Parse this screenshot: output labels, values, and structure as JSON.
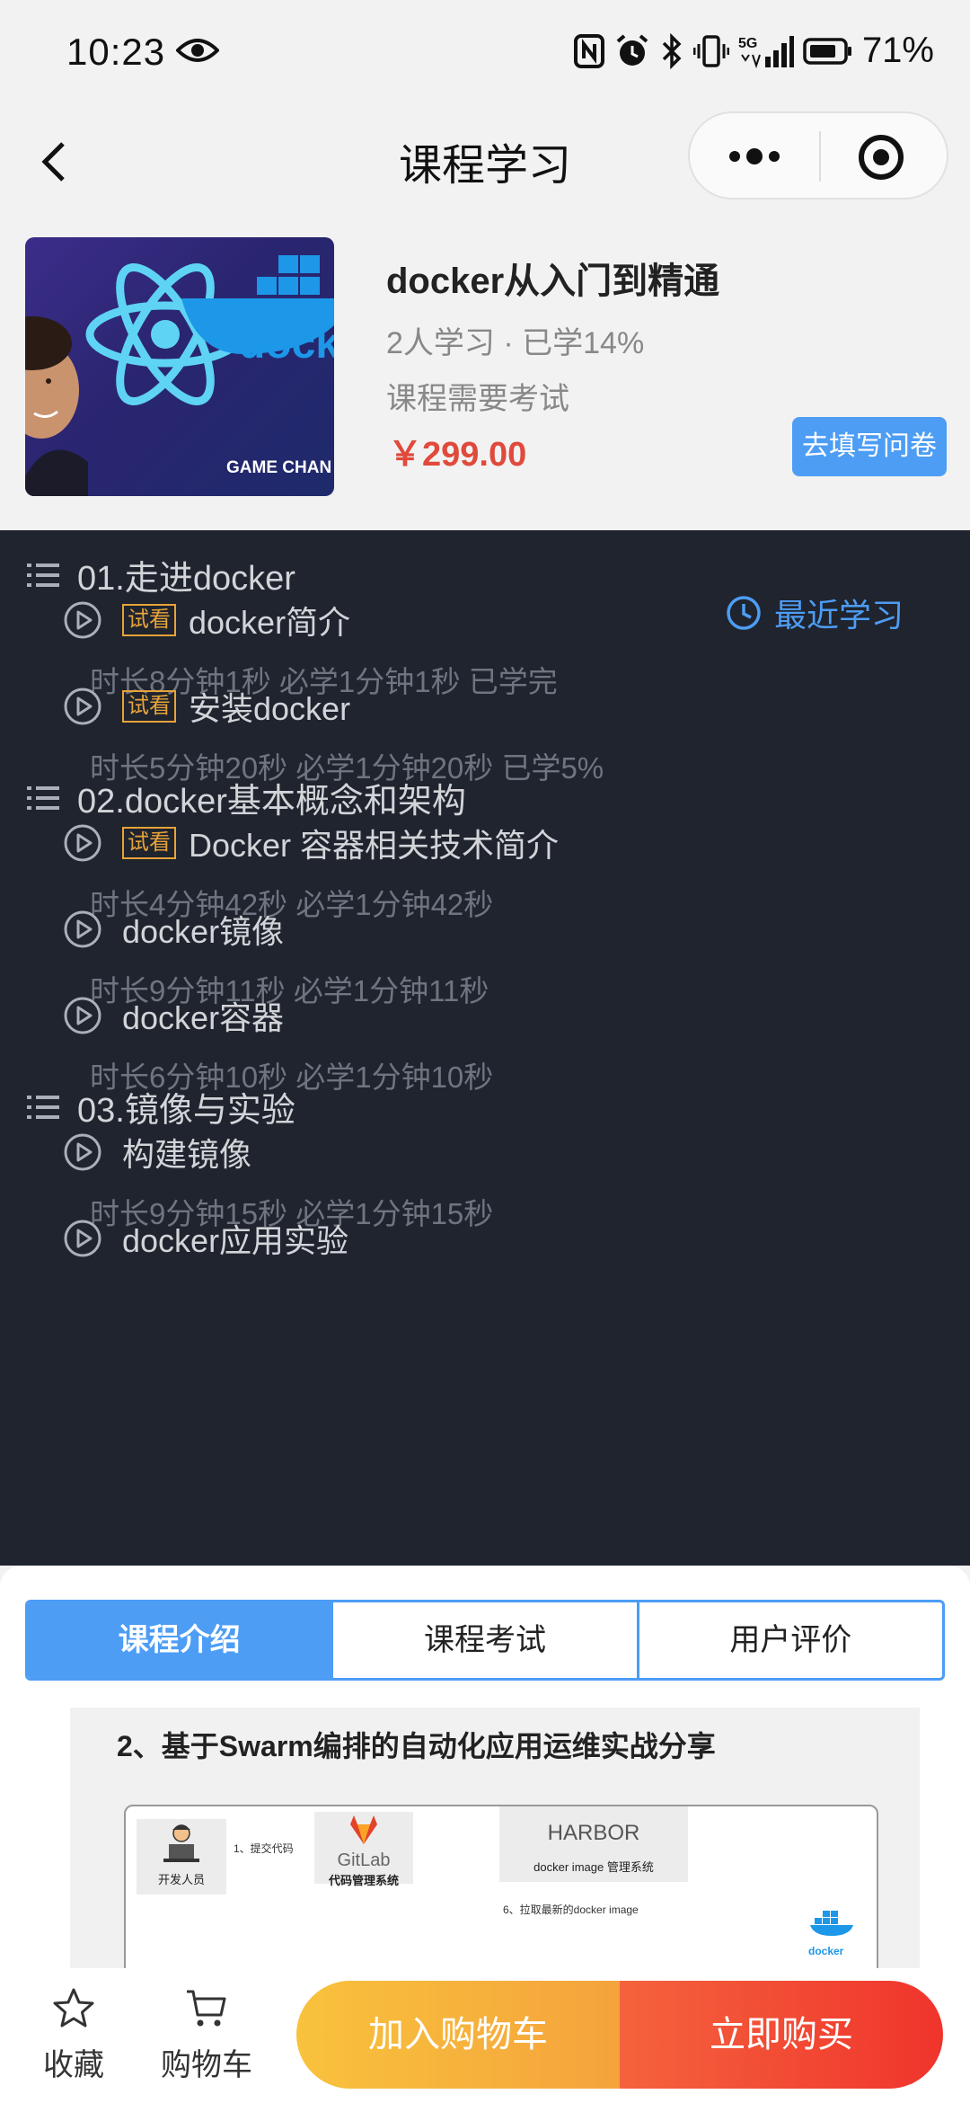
{
  "status_bar": {
    "time": "10:23",
    "network": "5G",
    "battery": "71%"
  },
  "nav": {
    "title": "课程学习"
  },
  "course": {
    "title": "docker从入门到精通",
    "meta": "2人学习  · 已学14%",
    "exam_note": "课程需要考试",
    "price": "￥299.00",
    "survey_label": "去填写问卷",
    "thumbnail_caption": "GAME CHAN"
  },
  "chapters": [
    {
      "title": "01.走进docker",
      "lessons": [
        {
          "trial": "试看",
          "name": "docker简介",
          "info": "时长8分钟1秒 必学1分钟1秒 已学完"
        },
        {
          "trial": "试看",
          "name": "安装docker",
          "info": "时长5分钟20秒 必学1分钟20秒 已学5%"
        }
      ]
    },
    {
      "title": "02.docker基本概念和架构",
      "lessons": [
        {
          "trial": "试看",
          "name": "Docker 容器相关技术简介",
          "info": "时长4分钟42秒 必学1分钟42秒"
        },
        {
          "name": "docker镜像",
          "info": "时长9分钟11秒 必学1分钟11秒"
        },
        {
          "name": "docker容器",
          "info": "时长6分钟10秒 必学1分钟10秒"
        }
      ]
    },
    {
      "title": "03.镜像与实验",
      "lessons": [
        {
          "name": "构建镜像",
          "info": "时长9分钟15秒 必学1分钟15秒"
        },
        {
          "name": "docker应用实验",
          "info": ""
        }
      ]
    }
  ],
  "recent_label": "最近学习",
  "tabs": [
    {
      "label": "课程介绍",
      "active": true
    },
    {
      "label": "课程考试",
      "active": false
    },
    {
      "label": "用户评价",
      "active": false
    }
  ],
  "intro": {
    "heading": "2、基于Swarm编排的自动化应用运维实战分享",
    "dev_label": "开发人员",
    "gitlab_name": "GitLab",
    "gitlab_label": "代码管理系统",
    "harbor_name": "HARBOR",
    "harbor_label": "docker image 管理系统",
    "step1": "1、提交代码",
    "step6": "6、拉取最新的docker image",
    "docker_label": "docker"
  },
  "action_bar": {
    "favorite_label": "收藏",
    "cart_label": "购物车",
    "add_cart_label": "加入购物车",
    "buy_now_label": "立即购买"
  },
  "colors": {
    "accent": "#4d9df5",
    "price": "#e04a3c",
    "trial_badge": "#e8a33a",
    "list_background": "#1f242e"
  }
}
